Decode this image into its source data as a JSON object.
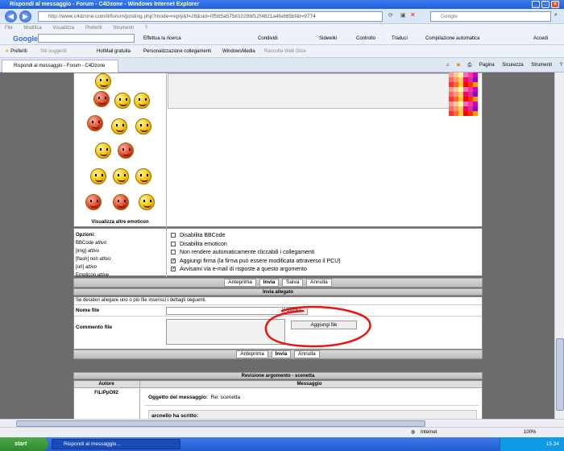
{
  "window": {
    "title": "Rispondi al messaggio - Forum - C4Dzone - Windows Internet Explorer"
  },
  "address": {
    "url": "http://www.c4dzone.com/it/forum/posting.php?mode=reply&f=28&sid=0f5b5a575810286f12f4821a4fe865bf&t=9774",
    "search_placeholder": "Google"
  },
  "menu": [
    "File",
    "Modifica",
    "Visualizza",
    "Preferiti",
    "Strumenti",
    "?"
  ],
  "google_toolbar": {
    "logo": "Google",
    "items": [
      "Effettua la ricerca",
      "Condividi",
      "Sidewiki",
      "Controllo",
      "Traduci",
      "Compilazione automatica",
      "Accedi"
    ]
  },
  "favorites": {
    "label": "Preferiti",
    "items": [
      "Siti suggeriti",
      "HotMail gratuita",
      "Personalizzazione collegamenti",
      "WindowsMedia",
      "Raccolta Web Slice"
    ]
  },
  "tab": {
    "label": "Rispondi al messaggio - Forum - C4Dzone"
  },
  "commandbar": [
    "Pagina",
    "Sicurezza",
    "Strumenti"
  ],
  "emoticons": {
    "more_link": "Visualizza altre emoticon"
  },
  "options": {
    "heading": "Opzioni:",
    "status": [
      {
        "label": "BBCode",
        "value": "attivo"
      },
      {
        "label": "[img]",
        "value": "attivo"
      },
      {
        "label": "[flash]",
        "value": "non attivo"
      },
      {
        "label": "[url]",
        "value": "attivo"
      },
      {
        "label": "Emoticon",
        "value": "attive"
      }
    ],
    "checkboxes": [
      {
        "label": "Disabilita BBCode",
        "checked": false
      },
      {
        "label": "Disabilita emoticon",
        "checked": false
      },
      {
        "label": "Non rendere automaticamente cliccabili i collegamenti",
        "checked": false
      },
      {
        "label": "Aggiungi firma (la firma può essere modificata attraverso il PCU)",
        "checked": true
      },
      {
        "label": "Avvisami via e-mail di risposte a questo argomento",
        "checked": true
      }
    ]
  },
  "buttons": {
    "preview": "Anteprima",
    "submit": "Invia",
    "save": "Salva",
    "cancel": "Annulla"
  },
  "attachment": {
    "heading": "Invia allegato",
    "hint": "Se desideri allegare uno o più file inserisci i dettagli seguenti.",
    "filename_label": "Nome file",
    "browse_button": "Sfoglia...",
    "comment_label": "Commento file",
    "add_button": "Aggiungi file"
  },
  "review": {
    "heading": "Revisione argomento - scenetta",
    "col_author": "Autore",
    "col_message": "Messaggio",
    "author": "FiLiPpO92",
    "subject_label": "Oggetto del messaggio:",
    "subject_value": "Re: scenetta",
    "quote": "arcnello ha scritto:"
  },
  "status": {
    "zone": "Internet",
    "zoom": "100%"
  },
  "taskbar": {
    "start": "start",
    "item": "Rispondi al messaggio...",
    "clock": "15.34"
  },
  "colors": {
    "ie_blue": "#1f5fd6",
    "forum_bg": "#6c6c6c",
    "annotation": "#e8140f"
  }
}
